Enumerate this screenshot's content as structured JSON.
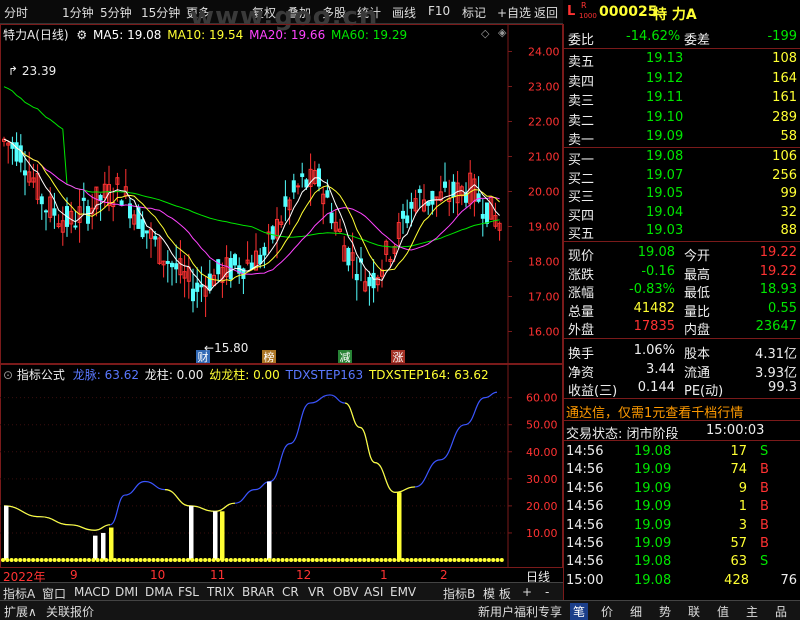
{
  "toolbar": {
    "items": [
      "分时",
      "1分钟",
      "5分钟",
      "15分钟",
      "更多",
      "复权",
      "叠加",
      "多股",
      "统计",
      "画线",
      "F10",
      "标记",
      "+自选",
      "返回"
    ]
  },
  "watermark": "www.goo.cn",
  "stock": {
    "flag1": "L",
    "flag2": "R",
    "flag3": "1000",
    "code": "000025",
    "name": "特 力A"
  },
  "mainchart": {
    "label": "特力A(日线)",
    "ma": [
      {
        "name": "MA5",
        "value": "19.08",
        "color": "#ffffff"
      },
      {
        "name": "MA10",
        "value": "19.54",
        "color": "#ffff33"
      },
      {
        "name": "MA20",
        "value": "19.66",
        "color": "#ff44ff"
      },
      {
        "name": "MA60",
        "value": "19.29",
        "color": "#00e600"
      }
    ],
    "high_label": "23.39",
    "low_label": "15.80",
    "yticks": [
      "24.00",
      "23.00",
      "22.00",
      "21.00",
      "20.00",
      "19.00",
      "18.00",
      "17.00",
      "16.00"
    ],
    "markers": [
      {
        "text": "财",
        "color": "#3a7bd5"
      },
      {
        "text": "榜",
        "color": "#c98a2a"
      },
      {
        "text": "减",
        "color": "#2e9a3e"
      },
      {
        "text": "涨",
        "color": "#c0392b"
      }
    ]
  },
  "indicator": {
    "title": "指标公式",
    "items": [
      {
        "name": "龙脉",
        "value": "63.62",
        "color": "#5a78ff"
      },
      {
        "name": "龙柱",
        "value": "0.00",
        "color": "#ffffff"
      },
      {
        "name": "幼龙柱",
        "value": "0.00",
        "color": "#ffff33"
      },
      {
        "name": "TDXSTEP163",
        "value": "",
        "color": "#5a78ff"
      },
      {
        "name": "TDXSTEP164",
        "value": "63.62",
        "color": "#ffff33"
      }
    ],
    "yticks": [
      "60.00",
      "50.00",
      "40.00",
      "30.00",
      "20.00",
      "10.00"
    ]
  },
  "xaxis": {
    "labels": [
      "2022年",
      "9",
      "10",
      "11",
      "12",
      "1",
      "2"
    ],
    "period": "日线"
  },
  "tabs": [
    "指标A",
    "窗口",
    "MACD",
    "DMI",
    "DMA",
    "FSL",
    "TRIX",
    "BRAR",
    "CR",
    "VR",
    "OBV",
    "ASI",
    "EMV",
    "指标B",
    "模 板",
    "+",
    "-"
  ],
  "bottombar": {
    "left": [
      "扩展∧",
      "关联报价"
    ],
    "right_text": "新用户福利专享",
    "icons": [
      "笔",
      "价",
      "细",
      "势",
      "联",
      "值",
      "主",
      "品"
    ]
  },
  "quote": {
    "weibi": {
      "label": "委比",
      "value": "-14.62%"
    },
    "weicha": {
      "label": "委差",
      "value": "-199"
    },
    "sell": [
      {
        "label": "卖五",
        "price": "19.13",
        "vol": "108"
      },
      {
        "label": "卖四",
        "price": "19.12",
        "vol": "164"
      },
      {
        "label": "卖三",
        "price": "19.11",
        "vol": "161"
      },
      {
        "label": "卖二",
        "price": "19.10",
        "vol": "289"
      },
      {
        "label": "卖一",
        "price": "19.09",
        "vol": "58"
      }
    ],
    "buy": [
      {
        "label": "买一",
        "price": "19.08",
        "vol": "106"
      },
      {
        "label": "买二",
        "price": "19.07",
        "vol": "256"
      },
      {
        "label": "买三",
        "price": "19.05",
        "vol": "99"
      },
      {
        "label": "买四",
        "price": "19.04",
        "vol": "32"
      },
      {
        "label": "买五",
        "price": "19.03",
        "vol": "88"
      }
    ],
    "stats": [
      {
        "l1": "现价",
        "v1": "19.08",
        "c1": "green",
        "l2": "今开",
        "v2": "19.22",
        "c2": "red"
      },
      {
        "l1": "涨跌",
        "v1": "-0.16",
        "c1": "green",
        "l2": "最高",
        "v2": "19.22",
        "c2": "red"
      },
      {
        "l1": "涨幅",
        "v1": "-0.83%",
        "c1": "green",
        "l2": "最低",
        "v2": "18.93",
        "c2": "green"
      },
      {
        "l1": "总量",
        "v1": "41482",
        "c1": "yellow",
        "l2": "量比",
        "v2": "0.55",
        "c2": "green"
      },
      {
        "l1": "外盘",
        "v1": "17835",
        "c1": "red",
        "l2": "内盘",
        "v2": "23647",
        "c2": "green"
      }
    ],
    "fin": [
      {
        "l1": "换手",
        "v1": "1.06%",
        "l2": "股本",
        "v2": "4.31亿"
      },
      {
        "l1": "净资",
        "v1": "3.44",
        "l2": "流通",
        "v2": "3.93亿"
      },
      {
        "l1": "收益(三)",
        "v1": "0.144",
        "l2": "PE(动)",
        "v2": "99.3"
      }
    ],
    "ad": "通达信，仅需1元查看千档行情",
    "status_label": "交易状态: 闭市阶段",
    "status_time": "15:00:03",
    "ticks": [
      {
        "t": "14:56",
        "p": "19.08",
        "v": "17",
        "s": "S"
      },
      {
        "t": "14:56",
        "p": "19.09",
        "v": "74",
        "s": "B"
      },
      {
        "t": "14:56",
        "p": "19.09",
        "v": "9",
        "s": "B"
      },
      {
        "t": "14:56",
        "p": "19.09",
        "v": "1",
        "s": "B"
      },
      {
        "t": "14:56",
        "p": "19.09",
        "v": "3",
        "s": "B"
      },
      {
        "t": "14:56",
        "p": "19.09",
        "v": "57",
        "s": "B"
      },
      {
        "t": "14:56",
        "p": "19.08",
        "v": "63",
        "s": "S"
      },
      {
        "t": "15:00",
        "p": "19.08",
        "v": "428",
        "s": "76"
      }
    ]
  }
}
